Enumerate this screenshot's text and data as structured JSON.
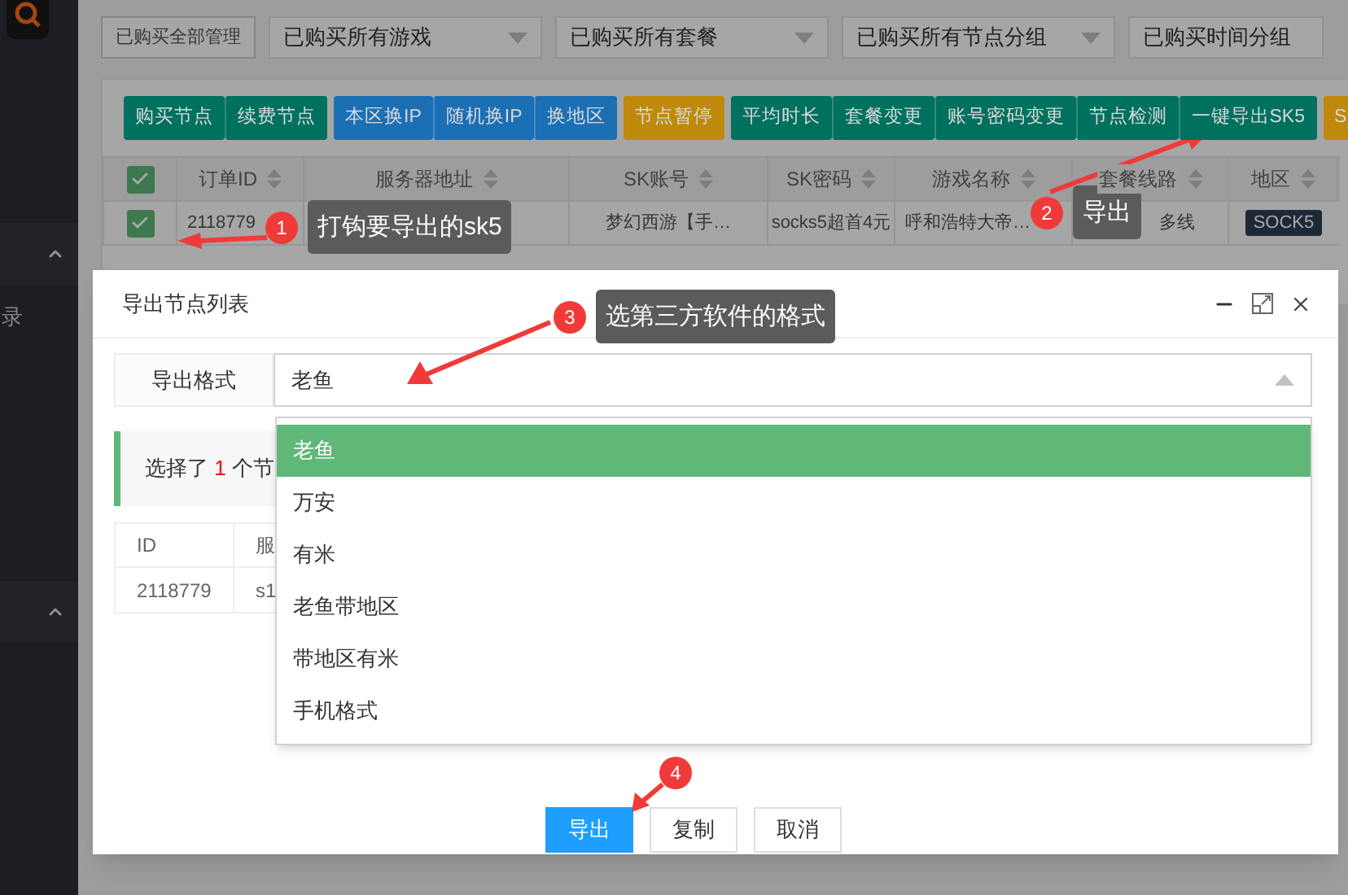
{
  "sidebar": {
    "items": [
      {
        "label": "录"
      }
    ]
  },
  "filters": {
    "manage_button": "已购买全部管理",
    "selects": [
      {
        "value": "已购买所有游戏"
      },
      {
        "value": "已购买所有套餐"
      },
      {
        "value": "已购买所有节点分组"
      },
      {
        "value": "已购买时间分组"
      }
    ]
  },
  "toolbar": [
    {
      "label": "购买节点",
      "color": "#00705f"
    },
    {
      "label": "续费节点",
      "color": "#00705f"
    },
    {
      "label": "本区换IP",
      "color": "#1b6fb5"
    },
    {
      "label": "随机换IP",
      "color": "#1b6fb5"
    },
    {
      "label": "换地区",
      "color": "#1b6fb5"
    },
    {
      "label": "节点暂停",
      "color": "#bf8a0b"
    },
    {
      "label": "平均时长",
      "color": "#00705f"
    },
    {
      "label": "套餐变更",
      "color": "#00705f"
    },
    {
      "label": "账号密码变更",
      "color": "#00705f"
    },
    {
      "label": "节点检测",
      "color": "#00705f"
    },
    {
      "label": "一键导出SK5",
      "color": "#00705f"
    },
    {
      "label": "S",
      "color": "#bf8a0b"
    }
  ],
  "table": {
    "header_checked": true,
    "columns": [
      "订单ID",
      "服务器地址",
      "SK账号",
      "SK密码",
      "游戏名称",
      "套餐线路",
      "地区"
    ],
    "rows": [
      {
        "checked": true,
        "cells": [
          "2118779",
          "",
          "梦幻西游【手…",
          "socks5超首4元",
          "呼和浩特大帝…",
          "多线"
        ],
        "region": "SOCK5"
      }
    ]
  },
  "dialog": {
    "title": "导出节点列表",
    "format_label": "导出格式",
    "format_value": "老鱼",
    "options": [
      {
        "label": "老鱼",
        "selected": true
      },
      {
        "label": "万安",
        "selected": false
      },
      {
        "label": "有米",
        "selected": false
      },
      {
        "label": "老鱼带地区",
        "selected": false
      },
      {
        "label": "带地区有米",
        "selected": false
      },
      {
        "label": "手机格式",
        "selected": false
      }
    ],
    "info": "选择了 **1** 个节",
    "table": {
      "columns": [
        "ID",
        "服"
      ],
      "rows": [
        [
          "2118779",
          "s1"
        ]
      ]
    },
    "buttons": [
      {
        "label": "导出",
        "kind": "primary"
      },
      {
        "label": "复制",
        "kind": "default"
      },
      {
        "label": "取消",
        "kind": "default"
      }
    ]
  },
  "annotations": [
    {
      "number": "1",
      "text": "打钩要导出的sk5"
    },
    {
      "number": "2",
      "text": "导出"
    },
    {
      "number": "3",
      "text": "选第三方软件的格式"
    },
    {
      "number": "4"
    }
  ]
}
